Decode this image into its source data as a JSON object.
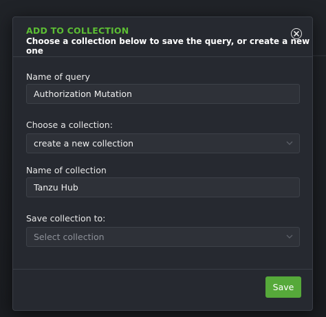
{
  "dialog": {
    "title": "ADD TO COLLECTION",
    "subtitle": "Choose a collection below to save the query, or create a new one",
    "close_icon": "close-circle-icon"
  },
  "fields": {
    "query_name": {
      "label": "Name of query",
      "value": "Authorization Mutation"
    },
    "collection": {
      "label": "Choose a collection:",
      "value": "create a new collection",
      "icon": "chevron-down-icon"
    },
    "collection_name": {
      "label": "Name of collection",
      "value": "Tanzu Hub"
    },
    "save_to": {
      "label": "Save collection to:",
      "placeholder": "Select collection",
      "icon": "chevron-down-icon"
    }
  },
  "footer": {
    "save_label": "Save"
  },
  "colors": {
    "accent": "#5cbd34",
    "button": "#56a93a",
    "background": "#262930"
  }
}
